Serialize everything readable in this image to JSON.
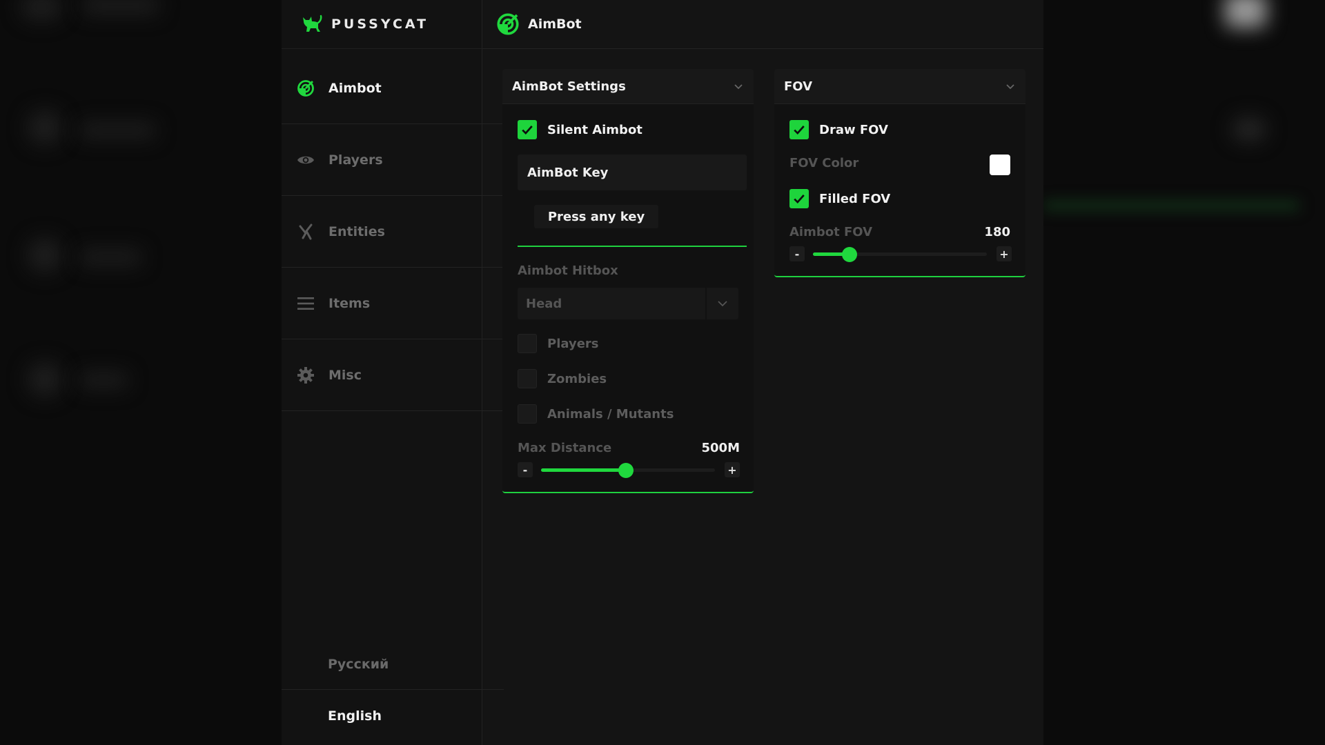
{
  "app": {
    "brand": "PUSSYCAT",
    "accent_color": "#20d83e",
    "page_title": "AimBot"
  },
  "sidebar": {
    "items": [
      {
        "label": "Aimbot",
        "icon": "radar-icon",
        "active": true
      },
      {
        "label": "Players",
        "icon": "eye-icon",
        "active": false
      },
      {
        "label": "Entities",
        "icon": "entities-icon",
        "active": false
      },
      {
        "label": "Items",
        "icon": "menu-icon",
        "active": false
      },
      {
        "label": "Misc",
        "icon": "gear-icon",
        "active": false
      }
    ],
    "languages": [
      {
        "label": "Русский",
        "selected": false
      },
      {
        "label": "English",
        "selected": true
      }
    ]
  },
  "aimbot_panel": {
    "title": "AimBot Settings",
    "silent_aimbot": {
      "label": "Silent Aimbot",
      "checked": true
    },
    "key_label": "AimBot Key",
    "key_button": "Press any key",
    "hitbox_label": "Aimbot Hitbox",
    "hitbox_value": "Head",
    "targets": [
      {
        "label": "Players",
        "checked": false
      },
      {
        "label": "Zombies",
        "checked": false
      },
      {
        "label": "Animals / Mutants",
        "checked": false
      }
    ],
    "max_distance": {
      "label": "Max Distance",
      "value": "500M",
      "fraction": 0.49,
      "minus": "-",
      "plus": "+"
    }
  },
  "fov_panel": {
    "title": "FOV",
    "draw_fov": {
      "label": "Draw FOV",
      "checked": true
    },
    "fov_color": {
      "label": "FOV Color",
      "color": "#ffffff"
    },
    "filled_fov": {
      "label": "Filled FOV",
      "checked": true
    },
    "aimbot_fov": {
      "label": "Aimbot FOV",
      "value": "180",
      "fraction": 0.21,
      "minus": "-",
      "plus": "+"
    }
  }
}
